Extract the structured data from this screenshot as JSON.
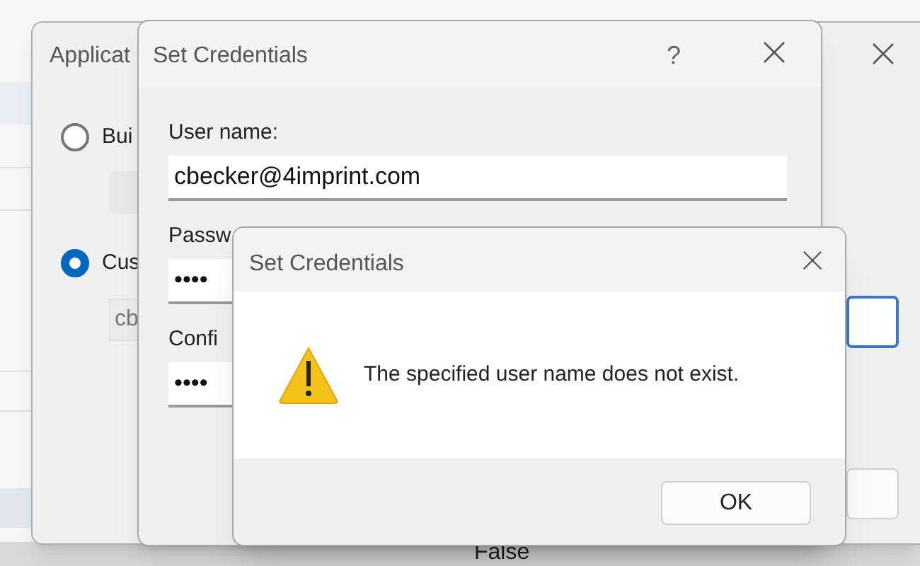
{
  "background": {
    "cell_text": "False"
  },
  "app_window": {
    "title": "Applicat",
    "options": [
      {
        "label": "Bui",
        "selected": false
      },
      {
        "label": "Cus",
        "selected": true
      }
    ],
    "field_value": "cb"
  },
  "credentials_window": {
    "title": "Set Credentials",
    "help": "?",
    "fields": [
      {
        "label": "User name:",
        "value": "cbecker@4imprint.com"
      },
      {
        "label": "Passw",
        "value": "••••"
      },
      {
        "label": "Confi",
        "value": "••••"
      }
    ]
  },
  "message_box": {
    "title": "Set Credentials",
    "message": "The specified user name does not exist.",
    "button": "OK"
  }
}
